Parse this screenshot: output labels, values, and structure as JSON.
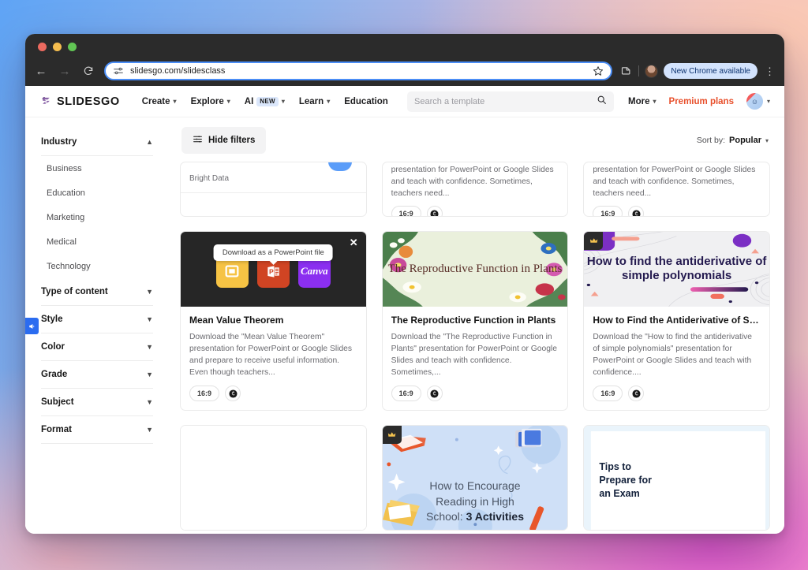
{
  "browser": {
    "back_icon": "back-arrow-icon",
    "forward_icon": "forward-arrow-icon",
    "reload_icon": "reload-icon",
    "url": "slidesgo.com/slidesclass",
    "site_settings_icon": "site-settings-icon",
    "bookmark_icon": "star-icon",
    "extensions_icon": "extensions-icon",
    "profile_icon": "profile-avatar",
    "update_pill": "New Chrome available",
    "menu_icon": "kebab-menu-icon"
  },
  "site_header": {
    "logo_text": "SLIDESGO",
    "logo_icon": "slidesgo-s-logo",
    "nav": [
      {
        "label": "Create",
        "has_caret": true,
        "badge": ""
      },
      {
        "label": "Explore",
        "has_caret": true,
        "badge": ""
      },
      {
        "label": "AI",
        "has_caret": true,
        "badge": "NEW"
      },
      {
        "label": "Learn",
        "has_caret": true,
        "badge": ""
      },
      {
        "label": "Education",
        "has_caret": false,
        "badge": ""
      }
    ],
    "search_placeholder": "Search a template",
    "search_value": "",
    "search_icon": "search-icon",
    "more_label": "More",
    "premium_label": "Premium plans",
    "avatar_icon": "user-avatar"
  },
  "sidebar": {
    "groups": [
      {
        "title": "Industry",
        "expanded": true,
        "options": [
          "Business",
          "Education",
          "Marketing",
          "Medical",
          "Technology"
        ]
      },
      {
        "title": "Type of content",
        "expanded": false,
        "options": []
      },
      {
        "title": "Style",
        "expanded": false,
        "options": []
      },
      {
        "title": "Color",
        "expanded": false,
        "options": []
      },
      {
        "title": "Grade",
        "expanded": false,
        "options": []
      },
      {
        "title": "Subject",
        "expanded": false,
        "options": []
      },
      {
        "title": "Format",
        "expanded": false,
        "options": []
      }
    ],
    "feedback_tab_icon": "megaphone-feedback-icon"
  },
  "toolbar": {
    "hide_filters_label": "Hide filters",
    "filters_icon": "filter-sliders-icon",
    "sort_label": "Sort by:",
    "sort_value": "Popular",
    "sort_caret_icon": "chevron-down-icon"
  },
  "partial_row": {
    "ad_label": "Bright Data",
    "desc": "presentation for PowerPoint or Google Slides and teach with confidence. Sometimes, teachers need...",
    "badge_ratio": "16:9",
    "badge_icon": "canva-circle-icon"
  },
  "overlay": {
    "tooltip": "Download as a PowerPoint file",
    "close_icon": "close-icon",
    "buttons": [
      {
        "name": "google-slides",
        "label": "",
        "color": "#f6c344"
      },
      {
        "name": "powerpoint",
        "label": "P",
        "color": "#d04423"
      },
      {
        "name": "canva",
        "label": "Canva",
        "color": "#8b2ff0"
      }
    ]
  },
  "cards": [
    {
      "title": "Mean Value Theorem",
      "desc": "Download the \"Mean Value Theorem\" presentation for PowerPoint or Google Slides and prepare to receive useful information. Even though teachers...",
      "ratio": "16:9",
      "badge_icon": "canva-circle-icon",
      "thumb_kind": "overlay",
      "thumb_title": ""
    },
    {
      "title": "The Reproductive Function in Plants",
      "desc": "Download the \"The Reproductive Function in Plants\" presentation for PowerPoint or Google Slides and teach with confidence. Sometimes,...",
      "ratio": "16:9",
      "badge_icon": "canva-circle-icon",
      "thumb_kind": "plants",
      "thumb_title": "The Reproductive Function in Plants"
    },
    {
      "title": "How to Find the Antiderivative of Sim...",
      "desc": "Download the \"How to find the antiderivative of simple polynomials\" presentation for PowerPoint or Google Slides and teach with confidence....",
      "ratio": "16:9",
      "badge_icon": "canva-circle-icon",
      "thumb_kind": "antiderivative",
      "thumb_title": "How to find the antiderivative of simple polynomials"
    }
  ],
  "bottom_row": [
    {
      "thumb_kind": "blank",
      "thumb_title": ""
    },
    {
      "thumb_kind": "reading",
      "thumb_title_1": "How to Encourage",
      "thumb_title_2": "Reading in High",
      "thumb_title_3": "School: ",
      "thumb_title_3b": "3 Activities"
    },
    {
      "thumb_kind": "exam",
      "thumb_title_1": "Tips to",
      "thumb_title_2": "Prepare for",
      "thumb_title_3": "an Exam"
    }
  ],
  "colors": {
    "accent_purple": "#8b2ff0",
    "premium_orange": "#e8502c",
    "brand_logo": "#8a63a8",
    "chrome_blue": "#4a8df6",
    "feedback_blue": "#2b6cf0"
  }
}
